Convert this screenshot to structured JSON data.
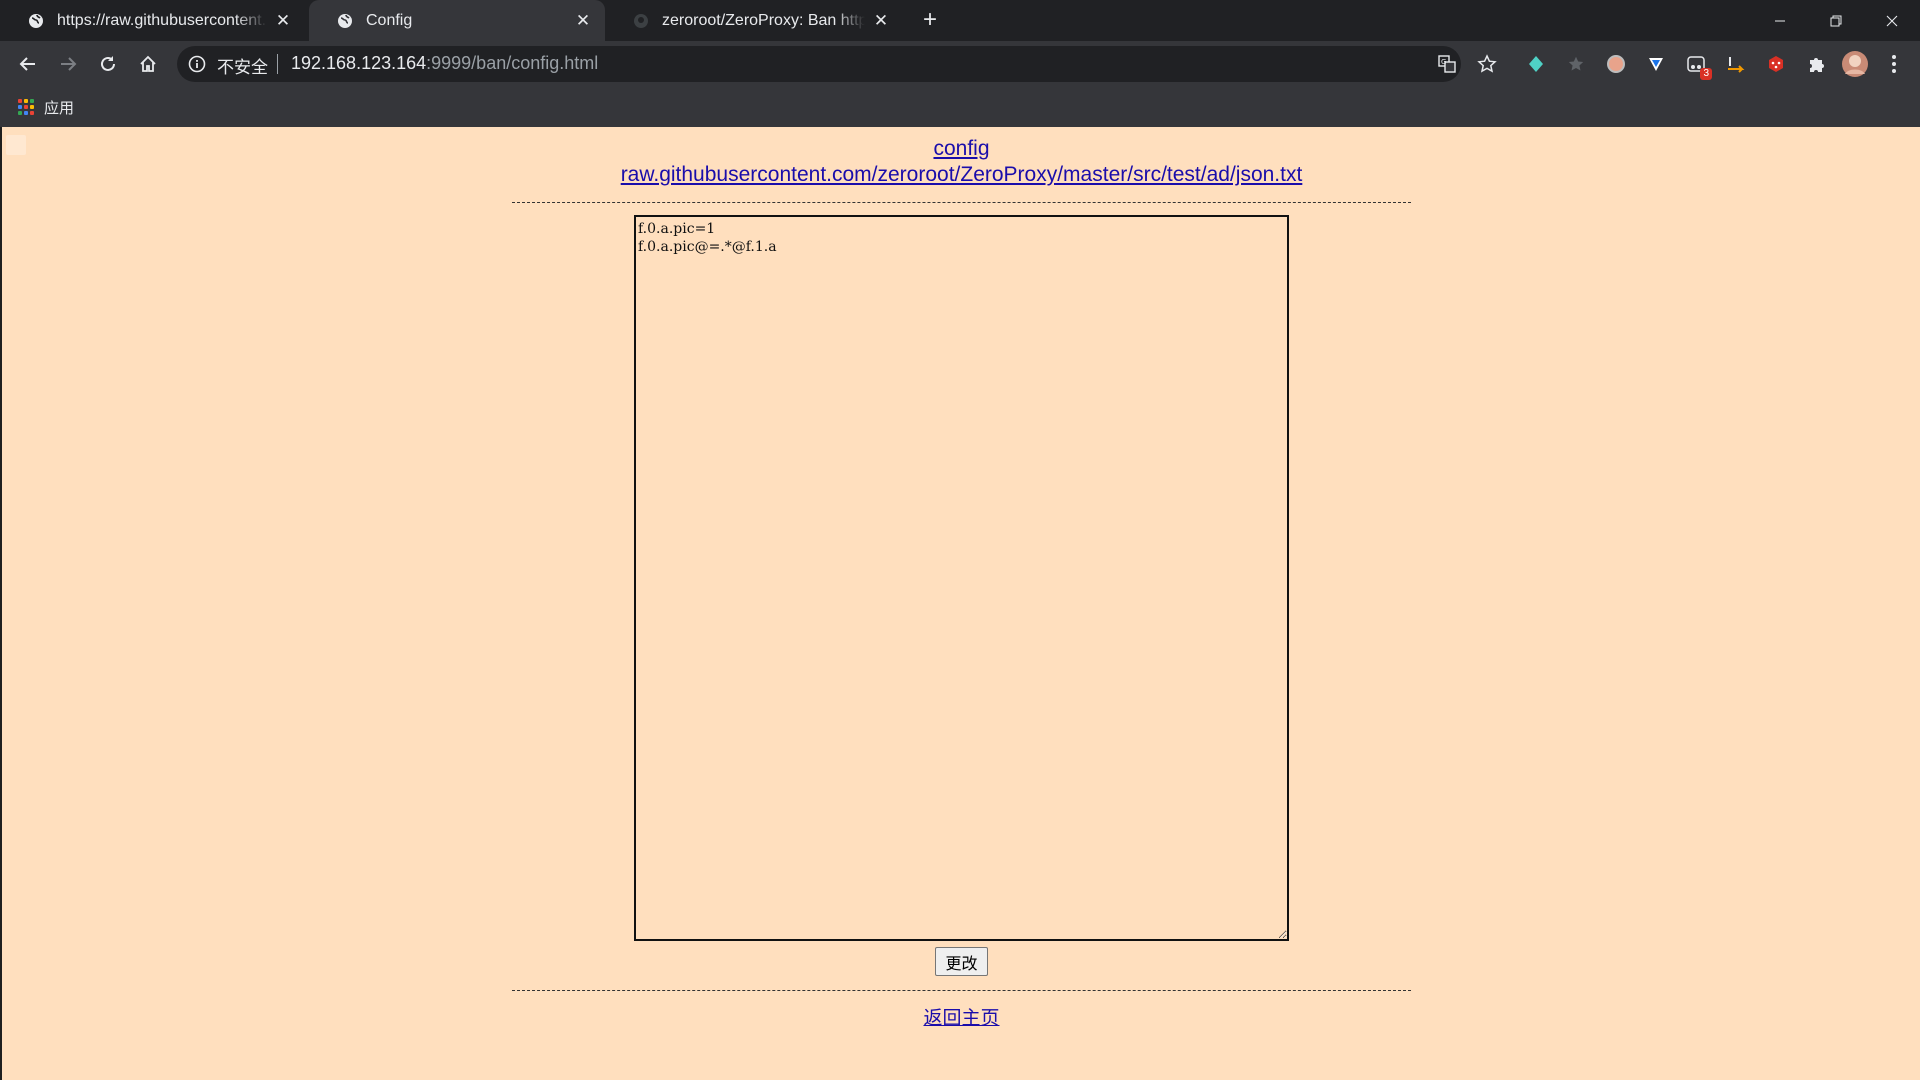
{
  "browser": {
    "tabs": [
      {
        "title": "https://raw.githubusercontent.com/zeroroot/ZeroProxy/master/src/test/ad/json.txt",
        "icon": "globe-icon",
        "active": false
      },
      {
        "title": "Config",
        "icon": "globe-icon",
        "active": true
      },
      {
        "title": "zeroroot/ZeroProxy: Ban http",
        "icon": "github-icon",
        "active": false
      }
    ],
    "address": {
      "security_label": "不安全",
      "host": "192.168.123.164",
      "rest": ":9999/ban/config.html"
    },
    "bookmarks": {
      "apps_label": "应用"
    },
    "extensions": [
      {
        "name": "crystal-extension-icon",
        "color": "#4fd1c5"
      },
      {
        "name": "star-extension-icon",
        "color": "#5f6368"
      },
      {
        "name": "circle-extension-icon",
        "color": "#e8a38b"
      },
      {
        "name": "shield-extension-icon",
        "color": "#ffffff"
      },
      {
        "name": "tampermonkey-extension-icon",
        "color": "#e8eaed",
        "badge": "3"
      },
      {
        "name": "translate-arrow-extension-icon",
        "color": "#f29900"
      },
      {
        "name": "dice-extension-icon",
        "color": "#d93025"
      }
    ]
  },
  "page": {
    "title_link": "config",
    "source_link": "raw.githubusercontent.com/zeroroot/ZeroProxy/master/src/test/ad/json.txt",
    "config_text": "f.0.a.pic=1\nf.0.a.pic@=.*@f.1.a",
    "submit_label": "更改",
    "back_link": "返回主页",
    "background_color": "#ffdfbe",
    "link_color": "#1a0dab"
  }
}
